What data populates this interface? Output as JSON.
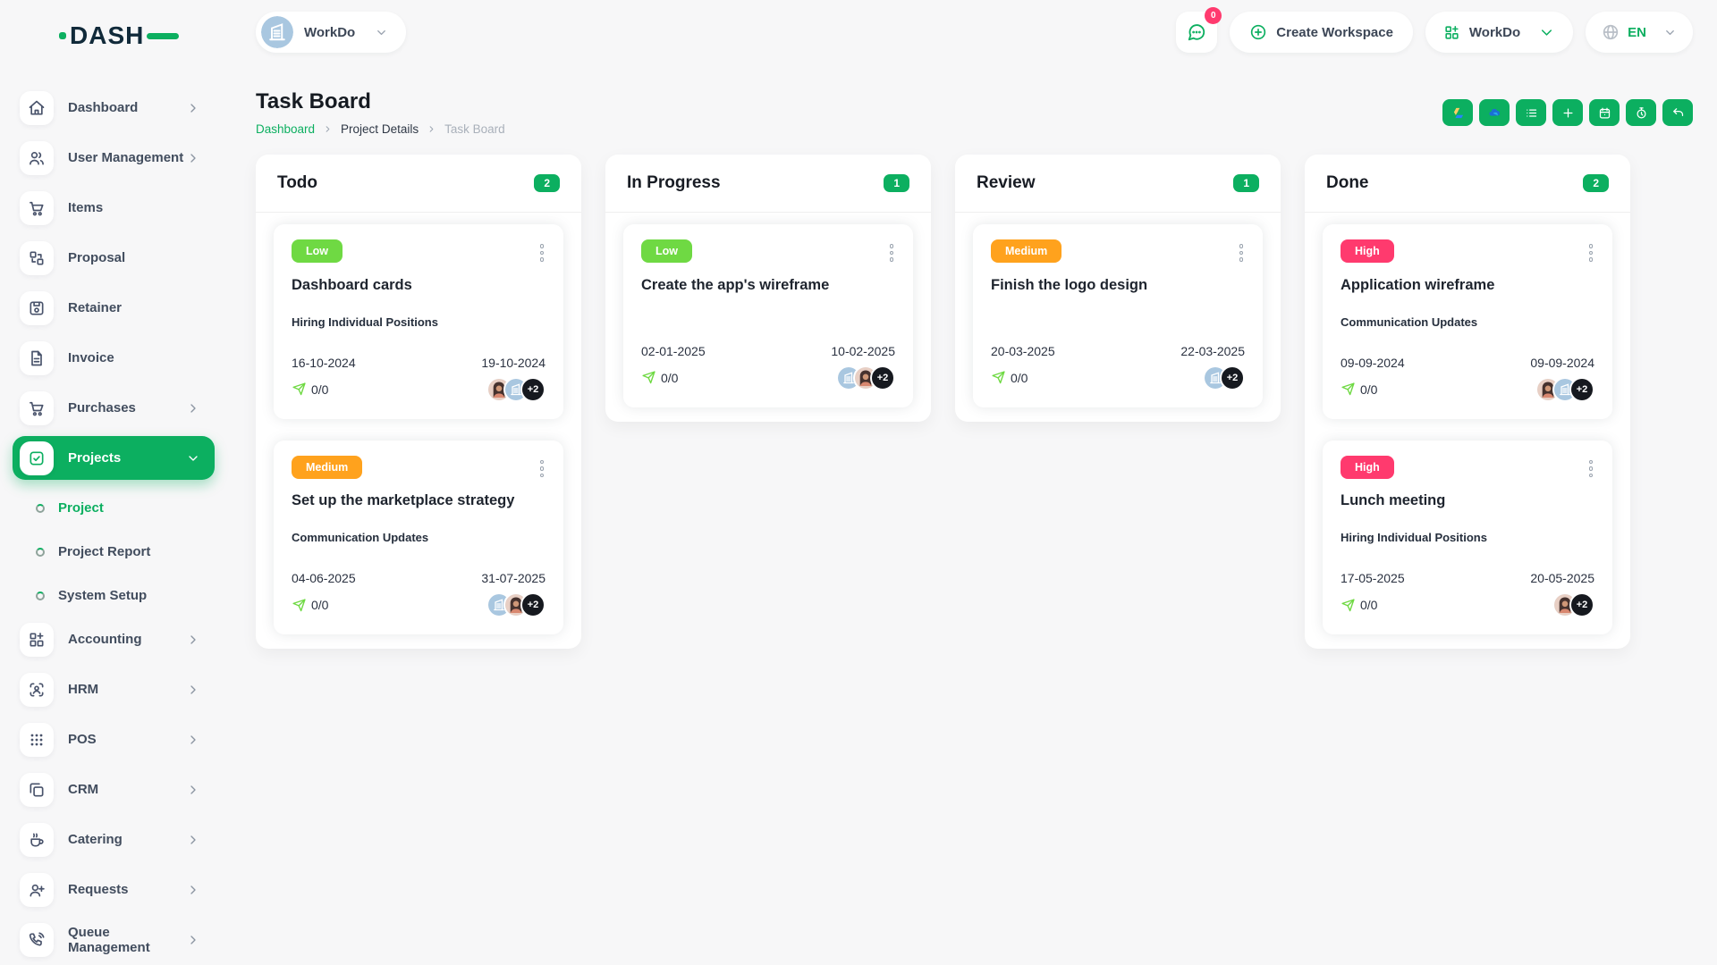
{
  "brand": {
    "name": "DASH"
  },
  "topbar": {
    "workspace_label": "WorkDo",
    "messages_badge": "0",
    "create_workspace_label": "Create Workspace",
    "app_switcher_label": "WorkDo",
    "language": "EN"
  },
  "sidebar": {
    "items": [
      {
        "label": "Dashboard",
        "icon": "home-icon",
        "chevron": true
      },
      {
        "label": "User Management",
        "icon": "users-icon",
        "chevron": true
      },
      {
        "label": "Items",
        "icon": "cart-icon",
        "chevron": false
      },
      {
        "label": "Proposal",
        "icon": "swap-boxes-icon",
        "chevron": false
      },
      {
        "label": "Retainer",
        "icon": "floppy-icon",
        "chevron": false
      },
      {
        "label": "Invoice",
        "icon": "file-text-icon",
        "chevron": false
      },
      {
        "label": "Purchases",
        "icon": "cart-icon",
        "chevron": true
      },
      {
        "label": "Projects",
        "icon": "check-square-icon",
        "chevron": true,
        "active": true,
        "submenu": [
          {
            "label": "Project",
            "active": true
          },
          {
            "label": "Project Report",
            "active": false
          },
          {
            "label": "System Setup",
            "active": false
          }
        ]
      },
      {
        "label": "Accounting",
        "icon": "grid-plus-icon",
        "chevron": true
      },
      {
        "label": "HRM",
        "icon": "user-scan-icon",
        "chevron": true
      },
      {
        "label": "POS",
        "icon": "dots-grid-icon",
        "chevron": true
      },
      {
        "label": "CRM",
        "icon": "copy-icon",
        "chevron": true
      },
      {
        "label": "Catering",
        "icon": "coffee-icon",
        "chevron": true
      },
      {
        "label": "Requests",
        "icon": "user-plus-icon",
        "chevron": true
      },
      {
        "label": "Queue Management",
        "icon": "phone-call-icon",
        "chevron": true
      }
    ]
  },
  "page": {
    "title": "Task Board",
    "breadcrumb": [
      {
        "label": "Dashboard",
        "style": "link"
      },
      {
        "label": "Project Details",
        "style": "text"
      },
      {
        "label": "Task Board",
        "style": "current"
      }
    ]
  },
  "toolbar": {
    "buttons": [
      {
        "name": "google-drive-button",
        "icon": "google-drive-icon"
      },
      {
        "name": "onedrive-button",
        "icon": "onedrive-icon"
      },
      {
        "name": "list-view-button",
        "icon": "list-icon"
      },
      {
        "name": "add-task-button",
        "icon": "plus-icon"
      },
      {
        "name": "calendar-button",
        "icon": "calendar-icon"
      },
      {
        "name": "timer-button",
        "icon": "timer-icon"
      },
      {
        "name": "back-button",
        "icon": "undo-icon"
      }
    ]
  },
  "board": {
    "columns": [
      {
        "title": "Todo",
        "count": "2",
        "cards": [
          {
            "priority": "Low",
            "title": "Dashboard cards",
            "subtitle": "Hiring Individual Positions",
            "start_date": "16-10-2024",
            "end_date": "19-10-2024",
            "progress": "0/0",
            "avatars": [
              "photo",
              "building"
            ],
            "extra": "+2"
          },
          {
            "priority": "Medium",
            "title": "Set up the marketplace strategy",
            "subtitle": "Communication Updates",
            "start_date": "04-06-2025",
            "end_date": "31-07-2025",
            "progress": "0/0",
            "avatars": [
              "building",
              "photo"
            ],
            "extra": "+2"
          }
        ]
      },
      {
        "title": "In Progress",
        "count": "1",
        "cards": [
          {
            "priority": "Low",
            "title": "Create the app's wireframe",
            "subtitle": "",
            "start_date": "02-01-2025",
            "end_date": "10-02-2025",
            "progress": "0/0",
            "avatars": [
              "building",
              "photo"
            ],
            "extra": "+2"
          }
        ]
      },
      {
        "title": "Review",
        "count": "1",
        "cards": [
          {
            "priority": "Medium",
            "title": "Finish the logo design",
            "subtitle": "",
            "start_date": "20-03-2025",
            "end_date": "22-03-2025",
            "progress": "0/0",
            "avatars": [
              "building"
            ],
            "extra": "+2"
          }
        ]
      },
      {
        "title": "Done",
        "count": "2",
        "cards": [
          {
            "priority": "High",
            "title": "Application wireframe",
            "subtitle": "Communication Updates",
            "start_date": "09-09-2024",
            "end_date": "09-09-2024",
            "progress": "0/0",
            "avatars": [
              "photo",
              "building"
            ],
            "extra": "+2"
          },
          {
            "priority": "High",
            "title": "Lunch meeting",
            "subtitle": "Hiring Individual Positions",
            "start_date": "17-05-2025",
            "end_date": "20-05-2025",
            "progress": "0/0",
            "avatars": [
              "photo"
            ],
            "extra": "+2"
          }
        ]
      }
    ]
  },
  "colors": {
    "primary": "#0CAF60",
    "low": "#6FD943",
    "medium": "#FFA21D",
    "high": "#FF3A6E",
    "notification": "#FF3A6E"
  }
}
